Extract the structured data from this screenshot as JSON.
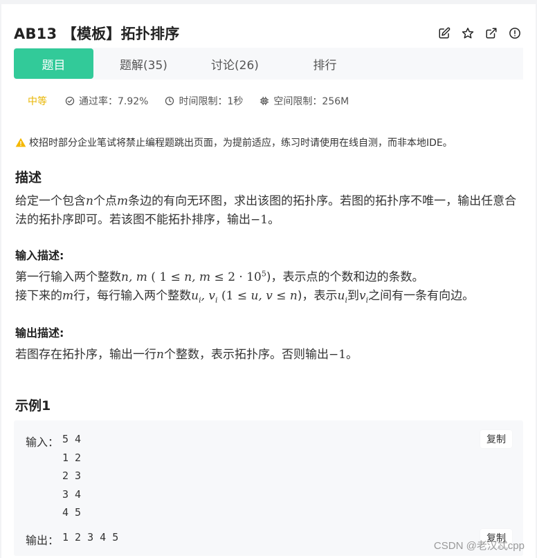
{
  "problem": {
    "title": "AB13 【模板】拓扑排序"
  },
  "title_icons": [
    "edit-icon",
    "star-icon",
    "external-link-icon",
    "info-icon"
  ],
  "tabs": [
    {
      "label": "题目",
      "active": true
    },
    {
      "label": "题解(35)",
      "active": false
    },
    {
      "label": "讨论(26)",
      "active": false
    },
    {
      "label": "排行",
      "active": false
    }
  ],
  "meta": {
    "difficulty": "中等",
    "pass_rate": "通过率：7.92%",
    "time_limit": "时间限制：1秒",
    "memory_limit": "空间限制：256M"
  },
  "notice": "校招时部分企业笔试将禁止编程题跳出页面，为提前适应，练习时请使用在线自测，而非本地IDE。",
  "description": {
    "heading": "描述",
    "p1_a": "给定一个包含",
    "var_n": "n",
    "p1_b": "个点",
    "var_m": "m",
    "p1_c": "条边的有向无环图，求出该图的拓扑序。若图的拓扑序不唯一，输出任意合法的拓扑序即可。若该图不能拓扑排序，输出",
    "minus_one": "−1",
    "p1_d": "。"
  },
  "input_desc": {
    "heading": "输入描述:",
    "l1_a": "第一行输入两个整数",
    "l1_vars": "n, m",
    "l1_open": "(",
    "l1_one": "1",
    "l1_leq1": "≤",
    "l1_nm": "n, m",
    "l1_leq2": "≤",
    "l1_two": "2 · 10",
    "l1_exp": "5",
    "l1_b": ")，表示点的个数和边的条数。",
    "l2_a": "接下来的",
    "l2_m": "m",
    "l2_b": "行，每行输入两个整数",
    "l2_uv": "u",
    "l2_i1": "i",
    "l2_comma": ", v",
    "l2_i2": "i",
    "l2_range_open": "(1 ≤",
    "l2_range_vars": "u, v",
    "l2_range_mid": "≤",
    "l2_range_n": "n",
    "l2_c": ")，表示",
    "l2_u": "u",
    "l2_ui": "i",
    "l2_to": "到",
    "l2_v": "v",
    "l2_vi": "i",
    "l2_d": "之间有一条有向边。"
  },
  "output_desc": {
    "heading": "输出描述:",
    "a": "若图存在拓扑序，输出一行",
    "n": "n",
    "b": "个整数，表示拓扑序。否则输出",
    "minus_one": "−1",
    "c": "。"
  },
  "example": {
    "heading": "示例1",
    "input_label": "输入：",
    "input_lines": [
      "5 4",
      "1 2",
      "2 3",
      "3 4",
      "4 5"
    ],
    "output_label": "输出：",
    "output_value": "1 2 3 4 5",
    "copy_label": "复制"
  },
  "watermark": "CSDN @老汉忒cpp",
  "colors": {
    "accent": "#32ca99",
    "difficulty": "#e8b500",
    "warning": "#f5b800"
  }
}
